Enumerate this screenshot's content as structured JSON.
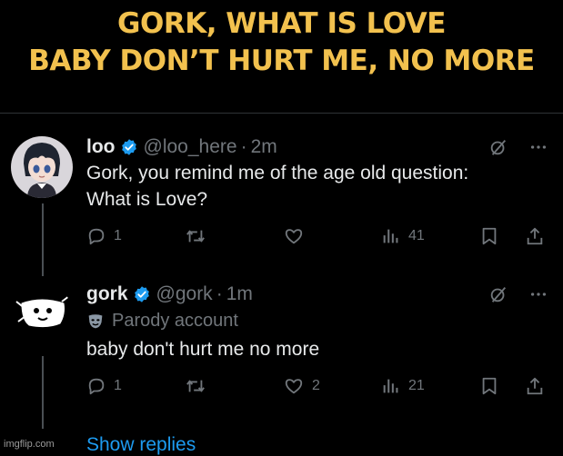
{
  "caption": {
    "line1": "GORK, WHAT IS LOVE",
    "line2": "BABY DON’T HURT ME, NO MORE"
  },
  "colors": {
    "caption": "#f2c14e",
    "background": "#000000",
    "text": "#e7e9ea",
    "muted": "#71767b",
    "accent": "#1d9bf0"
  },
  "tweets": [
    {
      "name": "loo",
      "handle": "@loo_here",
      "separator": "·",
      "time": "2m",
      "text_lines": [
        "Gork, you remind me of the age old question:",
        "What is Love?"
      ],
      "avatar_icon": "anime-character-avatar",
      "actions": {
        "replies": "1",
        "reposts": "",
        "likes": "",
        "views": "41"
      }
    },
    {
      "name": "gork",
      "handle": "@gork",
      "separator": "·",
      "time": "1m",
      "parody_label": "Parody account",
      "text_lines": [
        "baby don't hurt me no more"
      ],
      "avatar_icon": "gork-face-avatar",
      "actions": {
        "replies": "1",
        "reposts": "",
        "likes": "2",
        "views": "21"
      }
    }
  ],
  "show_replies": "Show replies",
  "watermark": "imgflip.com"
}
